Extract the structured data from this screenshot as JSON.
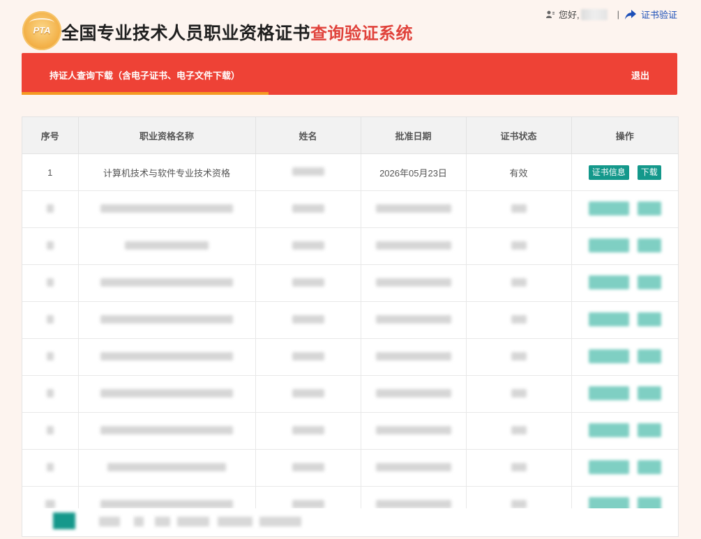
{
  "header": {
    "logo_text": "PTA",
    "title_main": "全国专业技术人员职业资格证书",
    "title_sub": "查询验证系统"
  },
  "user_bar": {
    "greeting": "您好,",
    "verify_label": "证书验证"
  },
  "nav": {
    "tab_label": "持证人查询下载（含电子证书、电子文件下载）",
    "logout_label": "退出",
    "bar_color": "#ee4236",
    "underline_color": "#f59a23"
  },
  "table": {
    "columns": [
      "序号",
      "职业资格名称",
      "姓名",
      "批准日期",
      "证书状态",
      "操作"
    ],
    "rows": [
      {
        "index": "1",
        "qualification": "计算机技术与软件专业技术资格",
        "approval_date": "2026年05月23日",
        "status": "有效",
        "info_button": "证书信息",
        "download_button": "下载"
      }
    ],
    "button_color": "#14988b"
  }
}
